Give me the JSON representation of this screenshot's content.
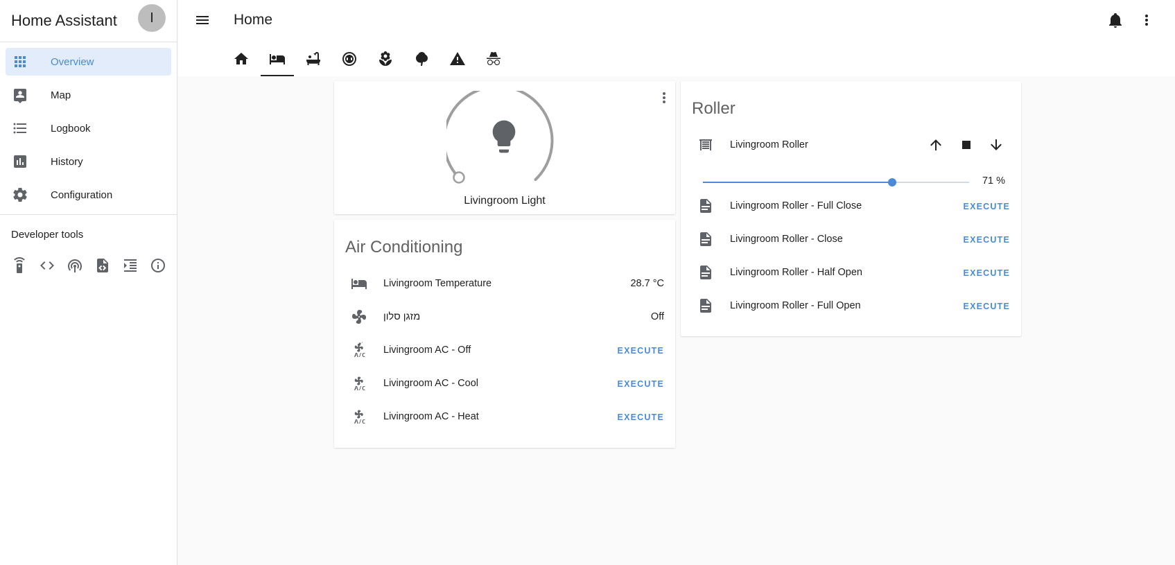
{
  "sidebar": {
    "title": "Home Assistant",
    "avatar_letter": "I",
    "items": [
      {
        "label": "Overview",
        "icon": "apps-icon",
        "active": true
      },
      {
        "label": "Map",
        "icon": "map-account-icon"
      },
      {
        "label": "Logbook",
        "icon": "format-list-bulleted-icon"
      },
      {
        "label": "History",
        "icon": "chart-box-icon"
      },
      {
        "label": "Configuration",
        "icon": "cog-icon"
      }
    ],
    "developer_tools_label": "Developer tools",
    "dev_tools": [
      "remote-icon",
      "code-brackets-icon",
      "access-point-icon",
      "file-code-icon",
      "file-indent-icon",
      "information-outline-icon"
    ]
  },
  "header": {
    "title": "Home",
    "tabs": [
      "home-icon",
      "bed-icon",
      "bathtub-icon",
      "robot-vacuum-icon",
      "flower-icon",
      "tree-icon",
      "alert-icon",
      "incognito-icon"
    ],
    "active_tab": 1
  },
  "light_card": {
    "name": "Livingroom Light"
  },
  "ac_card": {
    "title": "Air Conditioning",
    "rows": [
      {
        "name": "Livingroom Temperature",
        "state": "28.7 °C",
        "icon": "bed-icon"
      },
      {
        "name": "מזגן סלון",
        "state": "Off",
        "icon": "fan-icon"
      }
    ],
    "scripts": [
      {
        "name": "Livingroom AC - Off",
        "action": "EXECUTE",
        "icon": "air-conditioner-icon"
      },
      {
        "name": "Livingroom AC - Cool",
        "action": "EXECUTE",
        "icon": "air-conditioner-icon"
      },
      {
        "name": "Livingroom AC - Heat",
        "action": "EXECUTE",
        "icon": "air-conditioner-icon"
      }
    ]
  },
  "roller_card": {
    "title": "Roller",
    "cover": {
      "name": "Livingroom Roller",
      "icon": "window-shutter-icon"
    },
    "position_label": "71 %",
    "position_value": 71,
    "scripts": [
      {
        "name": "Livingroom Roller - Full Close",
        "action": "EXECUTE",
        "icon": "file-document-icon"
      },
      {
        "name": "Livingroom Roller - Close",
        "action": "EXECUTE",
        "icon": "file-document-icon"
      },
      {
        "name": "Livingroom Roller - Half Open",
        "action": "EXECUTE",
        "icon": "file-document-icon"
      },
      {
        "name": "Livingroom Roller - Full Open",
        "action": "EXECUTE",
        "icon": "file-document-icon"
      }
    ]
  },
  "colors": {
    "accent": "#4a8ad8",
    "icon": "#5f6368",
    "active_bg": "#e3ecfa"
  }
}
